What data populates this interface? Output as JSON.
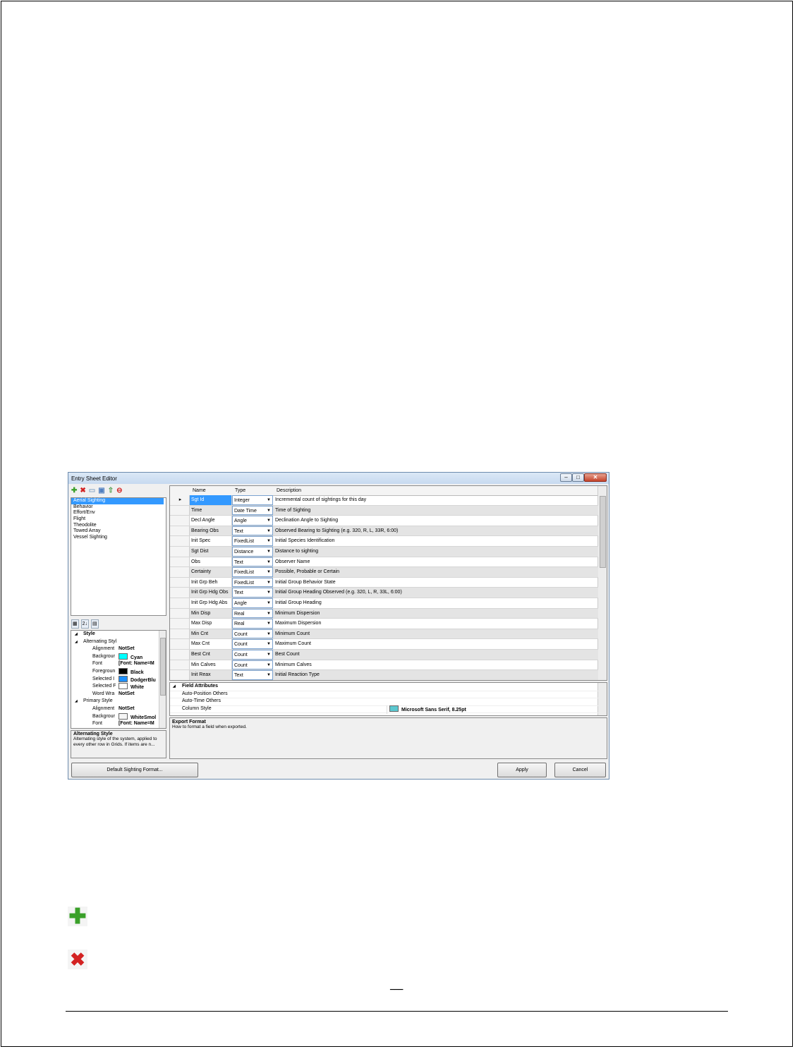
{
  "window": {
    "title": "Entry Sheet Editor",
    "controls": {
      "minimize": "–",
      "maximize": "□",
      "close": "✕"
    }
  },
  "toolbar": [
    {
      "icon": "add-icon",
      "glyph": "✚",
      "color": "#3aa029"
    },
    {
      "icon": "delete-icon",
      "glyph": "✖",
      "color": "#d32222"
    },
    {
      "icon": "copy-icon",
      "glyph": "▭",
      "color": "#8aa8c8"
    },
    {
      "icon": "save-icon",
      "glyph": "▣",
      "color": "#4f7fbf"
    },
    {
      "icon": "export-icon",
      "glyph": "⇧",
      "color": "#4a9a4a"
    },
    {
      "icon": "stop-icon",
      "glyph": "⊖",
      "color": "#d32222"
    }
  ],
  "sheets": [
    "Aerial Sighting",
    "Behavior",
    "Effort/Env",
    "Flight",
    "Theodolite",
    "Towed Array",
    "Vessel Sighting"
  ],
  "property_grid": {
    "toolbar": {
      "categorized": "▦",
      "alphabetical": "2↓",
      "pages": "▤"
    },
    "rows": [
      {
        "kind": "category",
        "label": "Style",
        "expander": "◢"
      },
      {
        "kind": "subcategory",
        "label": "Alternating Styl",
        "expander": "◢"
      },
      {
        "kind": "prop",
        "label": "Alignment",
        "value": "NotSet"
      },
      {
        "kind": "prop",
        "label": "Backgrour",
        "value": "Cyan",
        "swatch": "#00ffff"
      },
      {
        "kind": "prop",
        "label": "Font",
        "value": "[Font: Name=M"
      },
      {
        "kind": "prop",
        "label": "Foregroun",
        "value": "Black",
        "swatch": "#000000"
      },
      {
        "kind": "prop",
        "label": "Selected I",
        "value": "DodgerBlu",
        "swatch": "#1e90ff"
      },
      {
        "kind": "prop",
        "label": "Selected F",
        "value": "White",
        "swatch": "#ffffff"
      },
      {
        "kind": "prop",
        "label": "Word Wra",
        "value": "NotSet"
      },
      {
        "kind": "subcategory",
        "label": "Primary Style",
        "expander": "◢"
      },
      {
        "kind": "prop",
        "label": "Alignment",
        "value": "NotSet"
      },
      {
        "kind": "prop",
        "label": "Backgrour",
        "value": "WhiteSmol",
        "swatch": "#f5f5f5"
      },
      {
        "kind": "prop",
        "label": "Font",
        "value": "[Font: Name=M"
      }
    ],
    "help": {
      "title": "Alternating Style",
      "description": "Alternating style of the system, applied to every other row in Grids. If items are n..."
    }
  },
  "fields_grid": {
    "columns": {
      "name": "Name",
      "type": "Type",
      "description": "Description"
    },
    "current_row_marker": "▸",
    "dropdown_arrow": "▼",
    "rows": [
      {
        "name": "Sgt Id",
        "type": "Integer",
        "description": "Incremental count of sightings for this day"
      },
      {
        "name": "Time",
        "type": "Date Time",
        "description": "Time of Sighting"
      },
      {
        "name": "Decl Angle",
        "type": "Angle",
        "description": "Declination Angle to Sighting"
      },
      {
        "name": "Bearing Obs",
        "type": "Text",
        "description": "Observed Bearing to Sighting (e.g. 320, R, L, 33R, 6:00)"
      },
      {
        "name": "Init Spec",
        "type": "FixedList",
        "description": "Initial Species Identification"
      },
      {
        "name": "Sgt Dist",
        "type": "Distance",
        "description": "Distance to sighting"
      },
      {
        "name": "Obs",
        "type": "Text",
        "description": "Observer Name"
      },
      {
        "name": "Certainty",
        "type": "FixedList",
        "description": "Possible, Probable or Certain"
      },
      {
        "name": "Init Grp Beh",
        "type": "FixedList",
        "description": "Initial Group Behavior State"
      },
      {
        "name": "Init Grp Hdg Obs",
        "type": "Text",
        "description": "Initial Group Heading Observed (e.g. 320, L, R, 33L, 6:00)"
      },
      {
        "name": "Init Grp Hdg Abs",
        "type": "Angle",
        "description": "Initial Group Heading"
      },
      {
        "name": "Min Disp",
        "type": "Real",
        "description": "Minimum Dispersion"
      },
      {
        "name": "Max Disp",
        "type": "Real",
        "description": "Maximum Dispersion"
      },
      {
        "name": "Min Cnt",
        "type": "Count",
        "description": "Minimum Count"
      },
      {
        "name": "Max Cnt",
        "type": "Count",
        "description": "Maximum Count"
      },
      {
        "name": "Best Cnt",
        "type": "Count",
        "description": "Best Count"
      },
      {
        "name": "Min Calves",
        "type": "Count",
        "description": "Minimum Calves"
      },
      {
        "name": "Init Reax",
        "type": "Text",
        "description": "Initial Reaction Type"
      }
    ]
  },
  "field_attributes": {
    "category": "Field Attributes",
    "expander": "◢",
    "rows": [
      {
        "label": "Auto-Position Others",
        "value": ""
      },
      {
        "label": "Auto-Time Others",
        "value": ""
      },
      {
        "label": "Column Style",
        "value": "Microsoft Sans Serif, 8.25pt",
        "swatch": "#5bc8d0"
      }
    ],
    "help": {
      "title": "Export Format",
      "description": "How to format a field when exported."
    }
  },
  "buttons": {
    "default_format": "Default Sighting Format...",
    "apply": "Apply",
    "cancel": "Cancel"
  },
  "page_icons": {
    "add_glyph": "✚",
    "delete_glyph": "✖"
  },
  "page_number": "___"
}
